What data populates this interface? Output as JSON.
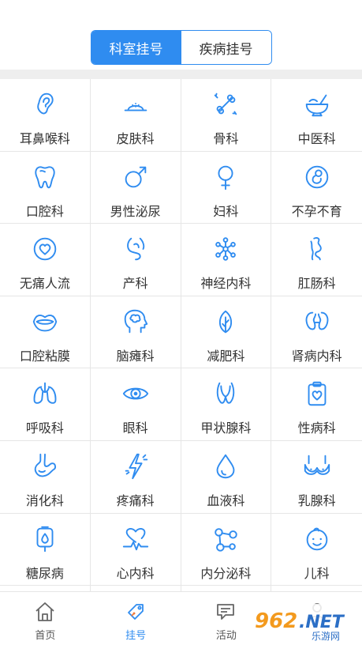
{
  "segment": {
    "tabs": [
      "科室挂号",
      "疾病挂号"
    ],
    "active_index": 0
  },
  "departments": [
    {
      "label": "耳鼻喉科",
      "icon": "ear-icon"
    },
    {
      "label": "皮肤科",
      "icon": "skin-icon"
    },
    {
      "label": "骨科",
      "icon": "bone-icon"
    },
    {
      "label": "中医科",
      "icon": "mortar-icon"
    },
    {
      "label": "口腔科",
      "icon": "tooth-icon"
    },
    {
      "label": "男性泌尿",
      "icon": "male-icon"
    },
    {
      "label": "妇科",
      "icon": "female-icon"
    },
    {
      "label": "不孕不育",
      "icon": "fetus-icon"
    },
    {
      "label": "无痛人流",
      "icon": "heart-circle-icon"
    },
    {
      "label": "产科",
      "icon": "pregnancy-icon"
    },
    {
      "label": "神经内科",
      "icon": "neuron-icon"
    },
    {
      "label": "肛肠科",
      "icon": "intestine-icon"
    },
    {
      "label": "口腔粘膜",
      "icon": "lips-icon"
    },
    {
      "label": "脑瘫科",
      "icon": "brain-head-icon"
    },
    {
      "label": "减肥科",
      "icon": "leaf-icon"
    },
    {
      "label": "肾病内科",
      "icon": "kidney-icon"
    },
    {
      "label": "呼吸科",
      "icon": "lungs-icon"
    },
    {
      "label": "眼科",
      "icon": "eye-icon"
    },
    {
      "label": "甲状腺科",
      "icon": "thyroid-icon"
    },
    {
      "label": "性病科",
      "icon": "clipboard-heart-icon"
    },
    {
      "label": "消化科",
      "icon": "stomach-icon"
    },
    {
      "label": "疼痛科",
      "icon": "lightning-icon"
    },
    {
      "label": "血液科",
      "icon": "drop-icon"
    },
    {
      "label": "乳腺科",
      "icon": "bra-icon"
    },
    {
      "label": "糖尿病",
      "icon": "iv-bag-icon"
    },
    {
      "label": "心内科",
      "icon": "heartbeat-icon"
    },
    {
      "label": "内分泌科",
      "icon": "molecule-icon"
    },
    {
      "label": "儿科",
      "icon": "baby-face-icon"
    },
    {
      "label": "",
      "icon": ""
    },
    {
      "label": "",
      "icon": ""
    },
    {
      "label": "",
      "icon": ""
    },
    {
      "label": "",
      "icon": ""
    }
  ],
  "tabbar": {
    "items": [
      {
        "label": "首页",
        "icon": "home-icon"
      },
      {
        "label": "挂号",
        "icon": "tag-icon"
      },
      {
        "label": "活动",
        "icon": "chat-icon"
      },
      {
        "label": "",
        "icon": "user-icon"
      }
    ],
    "active_index": 1
  },
  "watermark": {
    "text": "962.NET",
    "subtext": "乐游网"
  },
  "colors": {
    "accent": "#2f8cf0",
    "text": "#333333",
    "border": "#e6e6e6"
  }
}
